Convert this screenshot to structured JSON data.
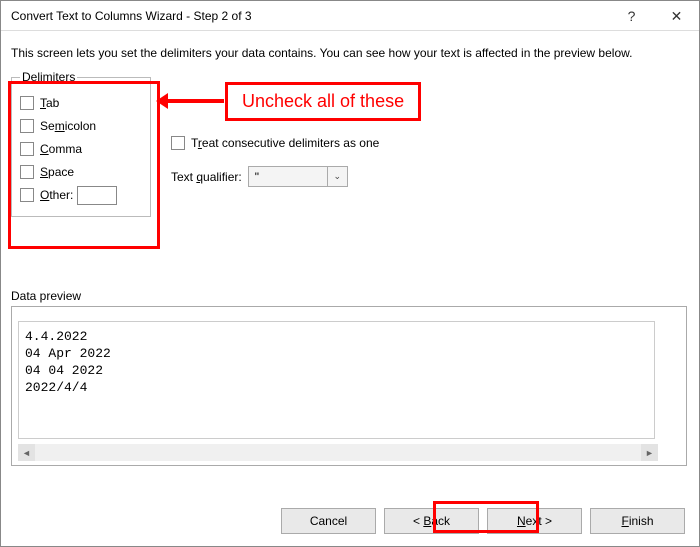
{
  "title": "Convert Text to Columns Wizard - Step 2 of 3",
  "help_glyph": "?",
  "close_glyph": "✕",
  "intro": "This screen lets you set the delimiters your data contains.  You can see how your text is affected in the preview below.",
  "delim": {
    "legend": "Delimiters",
    "tab": "Tab",
    "semicolon": "Semicolon",
    "comma": "Comma",
    "space": "Space",
    "other": "Other:"
  },
  "treat_consecutive": "Treat consecutive delimiters as one",
  "text_qualifier_label": "Text qualifier:",
  "text_qualifier_value": "\"",
  "preview_label": "Data preview",
  "preview_rows": [
    "4.4.2022",
    "04 Apr 2022",
    "04 04 2022",
    "2022/4/4"
  ],
  "buttons": {
    "cancel": "Cancel",
    "back": "< Back",
    "next": "Next >",
    "finish": "Finish"
  },
  "annotation": {
    "uncheck": "Uncheck all of these"
  },
  "scroll": {
    "left": "◄",
    "right": "►"
  },
  "select_arrow": "⌄"
}
